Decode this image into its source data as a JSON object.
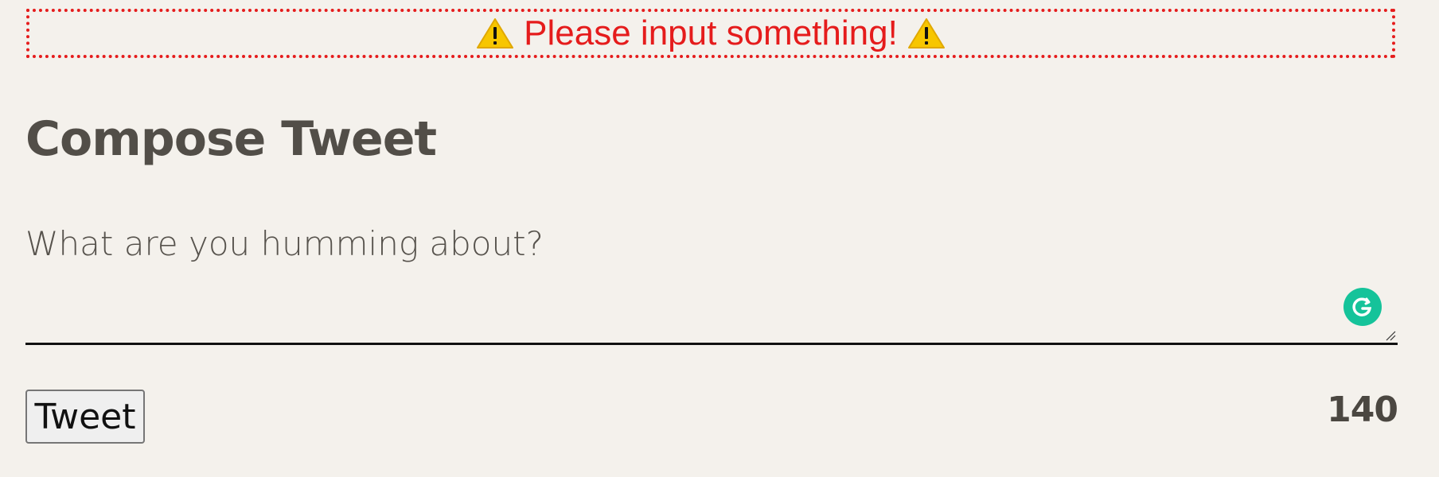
{
  "alert": {
    "message": "Please input something!",
    "icon": "warning-icon",
    "color": "#e51c1c"
  },
  "form": {
    "title": "Compose Tweet",
    "placeholder": "What are you humming about?",
    "value": "",
    "submit_label": "Tweet",
    "char_count": "140"
  },
  "colors": {
    "background": "#f4f1ec",
    "text": "#524e48",
    "grammarly": "#15c39a"
  }
}
